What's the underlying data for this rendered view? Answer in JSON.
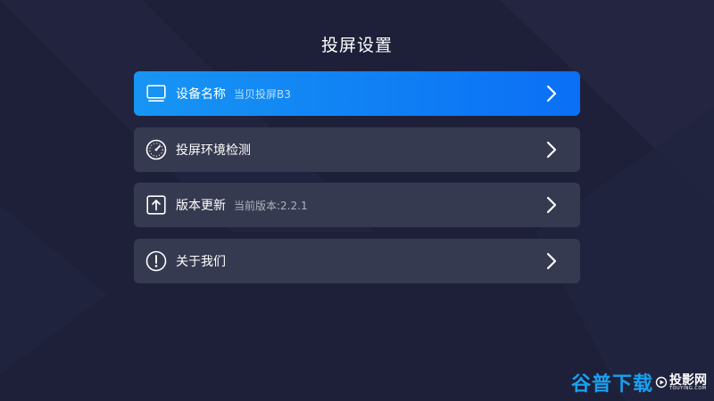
{
  "page": {
    "title": "投屏设置"
  },
  "menu": {
    "items": [
      {
        "id": "device-name",
        "label": "设备名称",
        "sub": "当贝投屏B3",
        "icon": "monitor-icon",
        "active": true
      },
      {
        "id": "env-check",
        "label": "投屏环境检测",
        "sub": "",
        "icon": "gauge-icon",
        "active": false
      },
      {
        "id": "version-update",
        "label": "版本更新",
        "sub": "当前版本:2.2.1",
        "icon": "upload-arrow-icon",
        "active": false
      },
      {
        "id": "about-us",
        "label": "关于我们",
        "sub": "",
        "icon": "info-exclamation-icon",
        "active": false
      }
    ]
  },
  "watermark": {
    "text1": "谷普下载",
    "text2": "投影网",
    "text3": "TOUYING.COM"
  },
  "colors": {
    "background": "#1e2039",
    "item_bg": "#363a50",
    "active_gradient_start": "#1795f4",
    "active_gradient_end": "#0a6ff5",
    "watermark_accent": "#1aa0f0"
  }
}
